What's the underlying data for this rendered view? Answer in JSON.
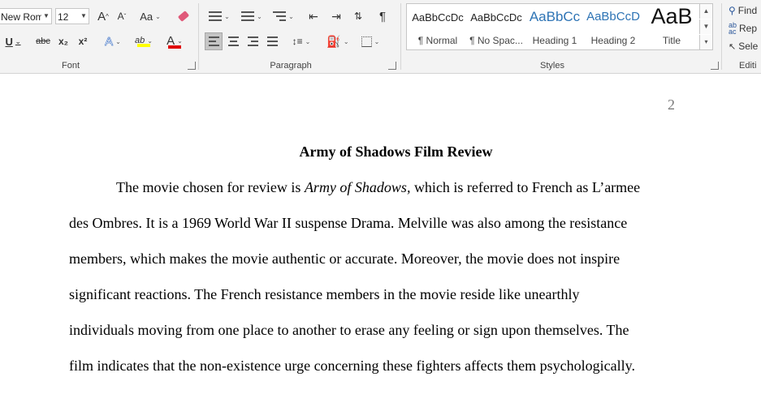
{
  "ribbon": {
    "font_group": {
      "label": "Font",
      "font_name": "New Roma",
      "font_size": "12",
      "grow_label": "A",
      "shrink_label": "A",
      "case_label": "Aa",
      "underline_label": "U",
      "strike_label": "abc",
      "subscript_label": "x₂",
      "superscript_label": "x²",
      "effects_label": "A",
      "highlight_label": "ab",
      "font_color_label": "A"
    },
    "paragraph_group": {
      "label": "Paragraph"
    },
    "styles_group": {
      "label": "Styles",
      "tiles": [
        {
          "sample": "AaBbCcDc",
          "name": "¶ Normal"
        },
        {
          "sample": "AaBbCcDc",
          "name": "¶ No Spac..."
        },
        {
          "sample": "AaBbCc",
          "name": "Heading 1"
        },
        {
          "sample": "AaBbCcD",
          "name": "Heading 2"
        },
        {
          "sample": "AaB",
          "name": "Title"
        }
      ]
    },
    "editing_group": {
      "label": "Editi",
      "find_label": "Find",
      "replace_label": "Rep",
      "select_label": "Sele"
    },
    "colors": {
      "highlight": "#ffff00",
      "font_color": "#e00000",
      "heading_blue": "#2e74b5"
    }
  },
  "document": {
    "page_number": "2",
    "title": "Army of Shadows Film Review",
    "line1_before": "The movie chosen for review is ",
    "line1_italic": "Army of Shadows,",
    "line1_after": " which is referred to French as L’armee",
    "lines": [
      "des Ombres. It is a 1969 World War II suspense Drama. Melville was also among the resistance",
      "members, which makes the movie authentic or accurate. Moreover, the movie does not inspire",
      "significant reactions. The French resistance members in the movie reside like unearthly",
      "individuals moving from one place to another to erase any feeling or sign upon themselves. The",
      "film indicates that the non-existence urge concerning these fighters affects them psychologically."
    ]
  }
}
